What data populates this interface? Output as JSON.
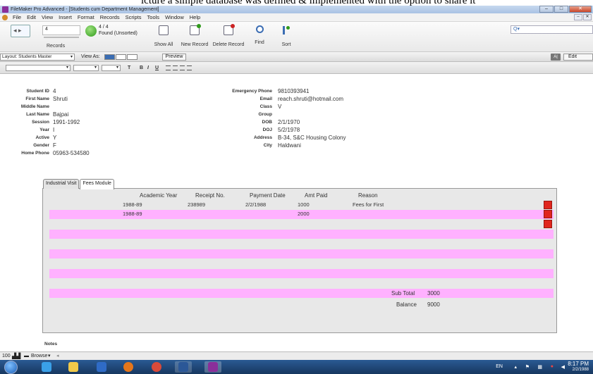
{
  "caption": "icture a simple database was defined & implemented with the option to share it",
  "window": {
    "title": "FileMaker Pro Advanced - [Students cum Department Management]",
    "controls": {
      "minimize": "–",
      "maximize": "□",
      "close": "✕"
    }
  },
  "menubar": {
    "items": [
      "File",
      "Edit",
      "View",
      "Insert",
      "Format",
      "Records",
      "Scripts",
      "Tools",
      "Window",
      "Help"
    ],
    "mdi": {
      "minimize": "–",
      "close": "✕"
    }
  },
  "toolbar": {
    "record_number": "4",
    "records_label": "Records",
    "found_count": "4 / 4",
    "found_status": "Found (Unsorted)",
    "buttons": {
      "show_all": "Show All",
      "new_record": "New Record",
      "delete_record": "Delete Record",
      "find": "Find",
      "sort": "Sort"
    },
    "search_placeholder": "Q▾"
  },
  "layoutbar": {
    "layout_label": "Layout:",
    "layout_value": "Students Master",
    "view_as_label": "View As:",
    "preview": "Preview",
    "aa": "A|",
    "edit_layout": "Edit Layout"
  },
  "formatbar": {
    "bold": "B",
    "italic": "I",
    "underline": "U",
    "text": "T"
  },
  "record": {
    "labels": {
      "student_id": "Student ID",
      "first_name": "First Name",
      "middle_name": "Middle Name",
      "last_name": "Last Name",
      "session": "Session",
      "year": "Year",
      "active": "Active",
      "gender": "Gender",
      "home_phone": "Home Phone",
      "emergency_phone": "Emergency Phone",
      "email": "Email",
      "class": "Class",
      "group": "Group",
      "dob": "DOB",
      "doj": "DOJ",
      "address": "Address",
      "city": "City"
    },
    "values": {
      "student_id": "4",
      "first_name": "Shruti",
      "middle_name": "",
      "last_name": "Bajpai",
      "session": "1991-1992",
      "year": "I",
      "active": "Y",
      "gender": "F",
      "home_phone": "05963-534580",
      "emergency_phone": "9810393941",
      "email": "reach.shruti@hotmail.com",
      "class": "V",
      "group": "",
      "dob": "2/1/1970",
      "doj": "5/2/1978",
      "address": "B-34, S&C Housing Colony",
      "city": "Haldwani"
    }
  },
  "tabs": [
    "Industrial Visit",
    "Fees Module"
  ],
  "fees_portal": {
    "headers": [
      "Academic Year",
      "Receipt No.",
      "Payment Date",
      "Amt Paid",
      "Reason"
    ],
    "rows": [
      [
        "1988-89",
        "238989",
        "2/2/1988",
        "1000",
        "Fees for First"
      ],
      [
        "1988-89",
        "",
        "",
        "2000",
        ""
      ]
    ],
    "sub_total_label": "Sub Total",
    "sub_total": "3000",
    "balance_label": "Balance",
    "balance": "9000"
  },
  "notes_label": "Notes",
  "statusbar": {
    "zoom": "100",
    "mode": "Browse"
  },
  "tray": {
    "lang": "EN",
    "time": "8:17 PM",
    "date": "2/2/1988"
  }
}
